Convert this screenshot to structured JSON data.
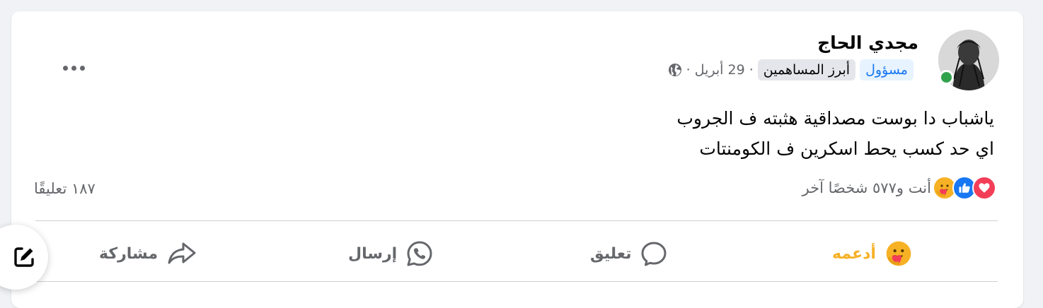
{
  "post": {
    "author": "مجدي الحاج",
    "badges": {
      "admin": "مسؤول",
      "top_contributor": "أبرز المساهمين"
    },
    "date": "· 29 أبريل ·",
    "privacy_icon": "globe-icon",
    "lines": [
      "ياشباب دا بوست مصداقية هثبته ف الجروب",
      "اي حد كسب يحط اسكرين ف الكومنتات"
    ],
    "online": true
  },
  "stats": {
    "reaction_icons": [
      "love-icon",
      "like-icon",
      "care-icon"
    ],
    "reactions_label": "أنت و٥٧٧ شخصًا آخر",
    "comments_label": "١٨٧ تعليقًا"
  },
  "actions": {
    "support": "أدعمه",
    "comment": "تعليق",
    "send": "إرسال",
    "share": "مشاركة"
  },
  "colors": {
    "accent": "#1877f2",
    "support": "#f7b125",
    "love": "#f33e58",
    "online": "#31a24c",
    "secondary_text": "#65676b"
  }
}
